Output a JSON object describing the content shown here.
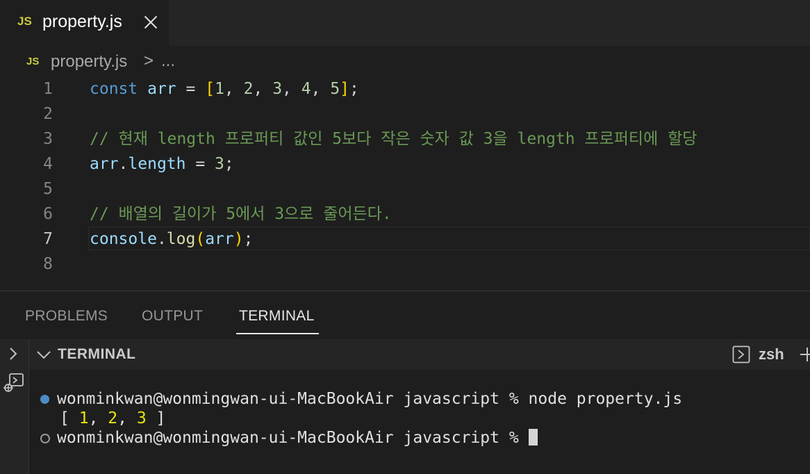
{
  "tab": {
    "lang_badge": "JS",
    "filename": "property.js"
  },
  "breadcrumb": {
    "lang_badge": "JS",
    "file": "property.js",
    "separator": ">",
    "more": "..."
  },
  "editor": {
    "active_line": 7,
    "lines": [
      {
        "number": "1",
        "text": "const arr = [1, 2, 3, 4, 5];"
      },
      {
        "number": "2",
        "text": ""
      },
      {
        "number": "3",
        "text": "// 현재 length 프로퍼티 값인 5보다 작은 숫자 값 3을 length 프로퍼티에 할당"
      },
      {
        "number": "4",
        "text": "arr.length = 3;"
      },
      {
        "number": "5",
        "text": ""
      },
      {
        "number": "6",
        "text": "// 배열의 길이가 5에서 3으로 줄어든다."
      },
      {
        "number": "7",
        "text": "console.log(arr);"
      },
      {
        "number": "8",
        "text": ""
      }
    ]
  },
  "panel": {
    "tabs": [
      {
        "label": "PROBLEMS",
        "active": false
      },
      {
        "label": "OUTPUT",
        "active": false
      },
      {
        "label": "TERMINAL",
        "active": true
      }
    ]
  },
  "terminal": {
    "header_title": "TERMINAL",
    "shell_name": "zsh",
    "prompt": "wonminkwan@wonmingwan-ui-MacBookAir javascript %",
    "command": "node property.js",
    "output": "[ 1, 2, 3 ]",
    "output_values": [
      "1",
      "2",
      "3"
    ]
  },
  "colors": {
    "background": "#1e1e1e",
    "keyword": "#569cd6",
    "variable": "#9cdcfe",
    "function": "#dcdcaa",
    "number": "#b5cea8",
    "comment": "#6a9955",
    "bracket_gold": "#ffd700",
    "bracket_purple": "#da70d6",
    "js_badge": "#cbcb41",
    "terminal_number": "#e5e510",
    "status_dot_blue": "#4b8ec5"
  },
  "icons": [
    "close-icon",
    "chevron-right-icon",
    "chevron-down-icon",
    "debug-icon",
    "terminal-shell-icon",
    "plus-icon"
  ]
}
